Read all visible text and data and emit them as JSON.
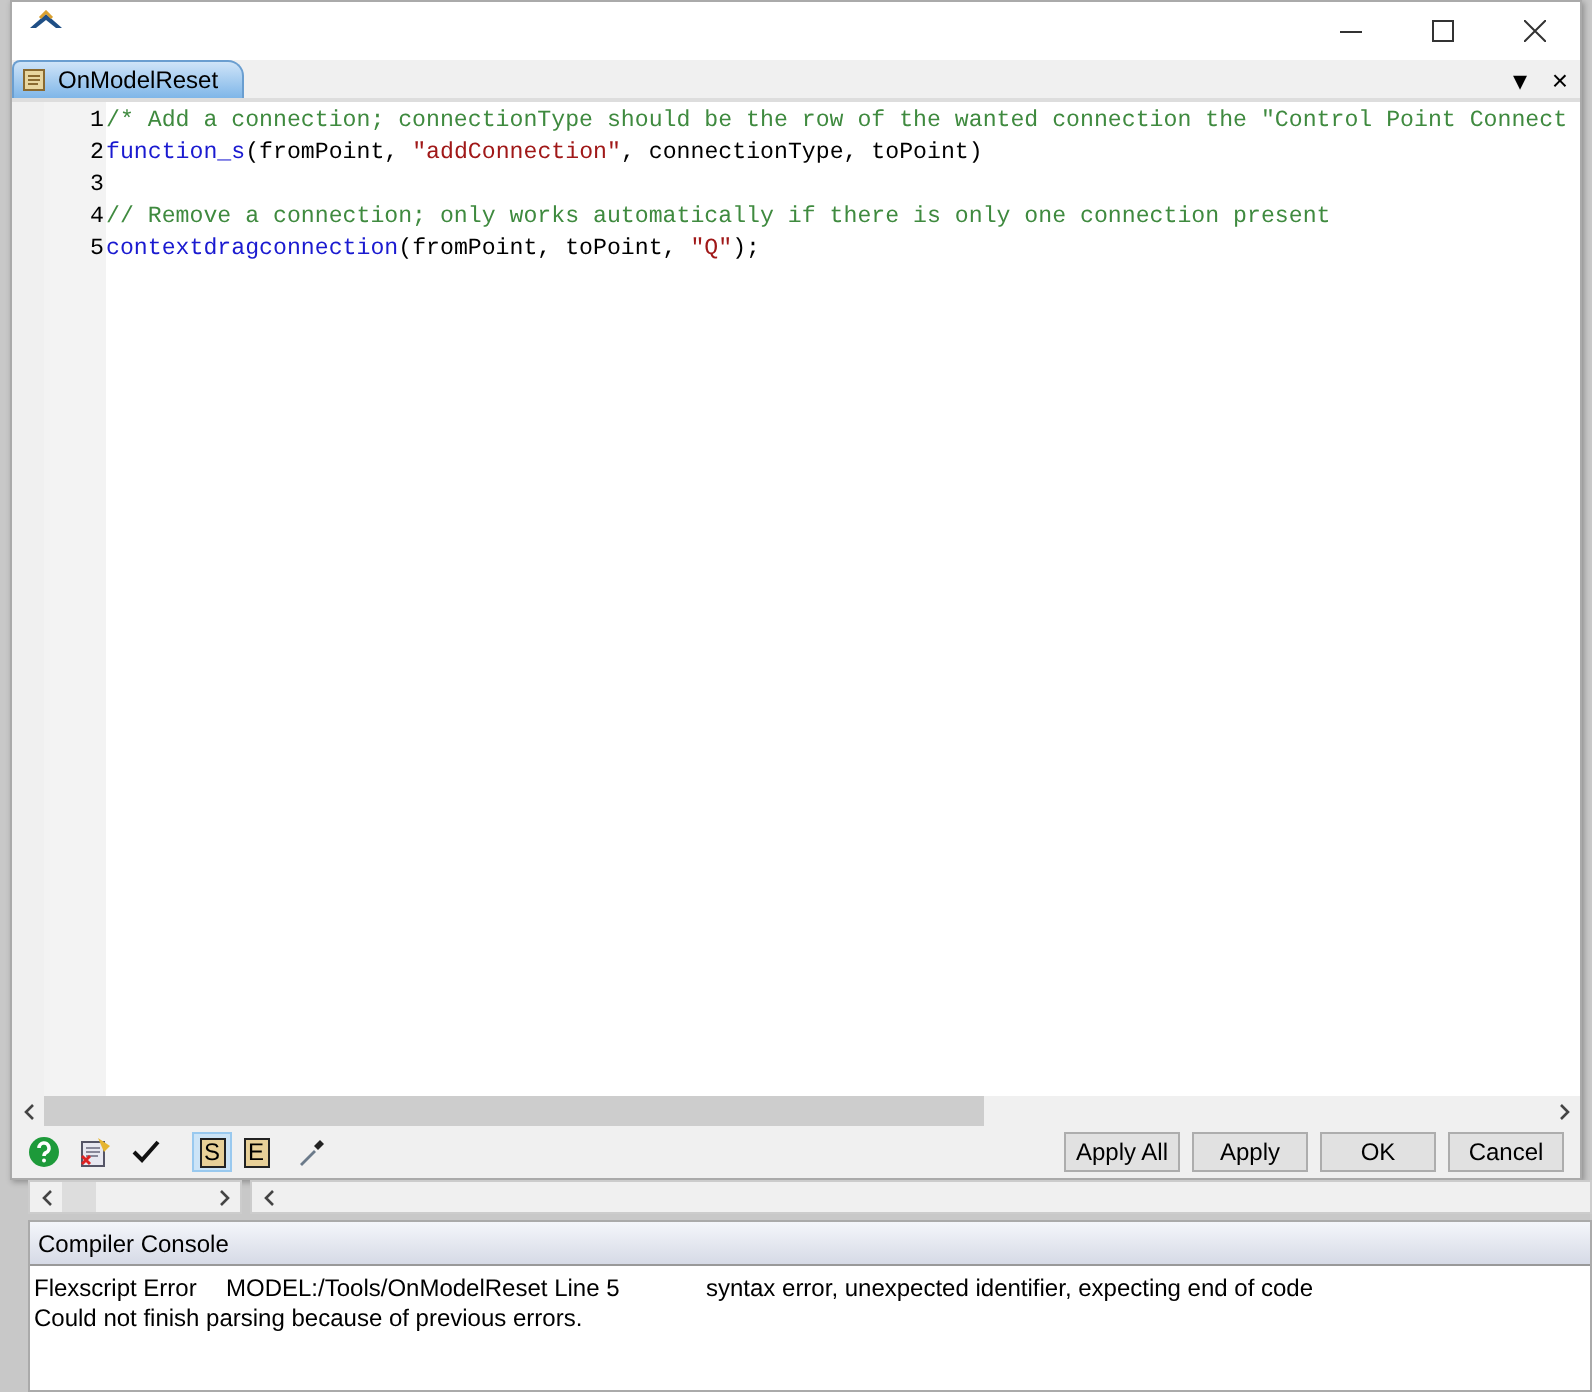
{
  "tabs": [
    {
      "label": "OnModelReset",
      "selected": true
    }
  ],
  "tab_strip_buttons": [
    "▾",
    "×"
  ],
  "editor": {
    "lines": [
      {
        "number": "1",
        "tokens": [
          {
            "kind": "comment",
            "text": "/* Add a connection; connectionType should be the row of the wanted connection the \"Control Point Connect"
          }
        ]
      },
      {
        "number": "2",
        "tokens": [
          {
            "kind": "keyword",
            "text": "function_s"
          },
          {
            "kind": "plain",
            "text": "(fromPoint, "
          },
          {
            "kind": "string",
            "text": "\"addConnection\""
          },
          {
            "kind": "plain",
            "text": ", connectionType, toPoint)"
          }
        ]
      },
      {
        "number": "3"
      },
      {
        "number": "4",
        "tokens": [
          {
            "kind": "comment",
            "text": "// Remove a connection; only works automatically if there is only one connection present"
          }
        ]
      },
      {
        "number": "5",
        "tokens": [
          {
            "kind": "keyword",
            "text": "contextdragconnection"
          },
          {
            "kind": "plain",
            "text": "(fromPoint, toPoint, "
          },
          {
            "kind": "string",
            "text": "\"Q\""
          },
          {
            "kind": "plain",
            "text": ");"
          }
        ]
      }
    ]
  },
  "toolbar": {
    "toggles": [
      {
        "label": "S",
        "selected": true
      },
      {
        "label": "E",
        "selected": false
      }
    ]
  },
  "buttons": [
    "Apply All",
    "Apply",
    "OK",
    "Cancel"
  ],
  "console": {
    "title": "Compiler Console",
    "lines": [
      {
        "columns": [
          "Flexscript Error",
          "MODEL:/Tools/OnModelReset Line 5",
          "syntax error, unexpected identifier, expecting end of code"
        ]
      },
      {
        "columns": [
          "Could not finish parsing because of previous errors."
        ]
      }
    ]
  }
}
